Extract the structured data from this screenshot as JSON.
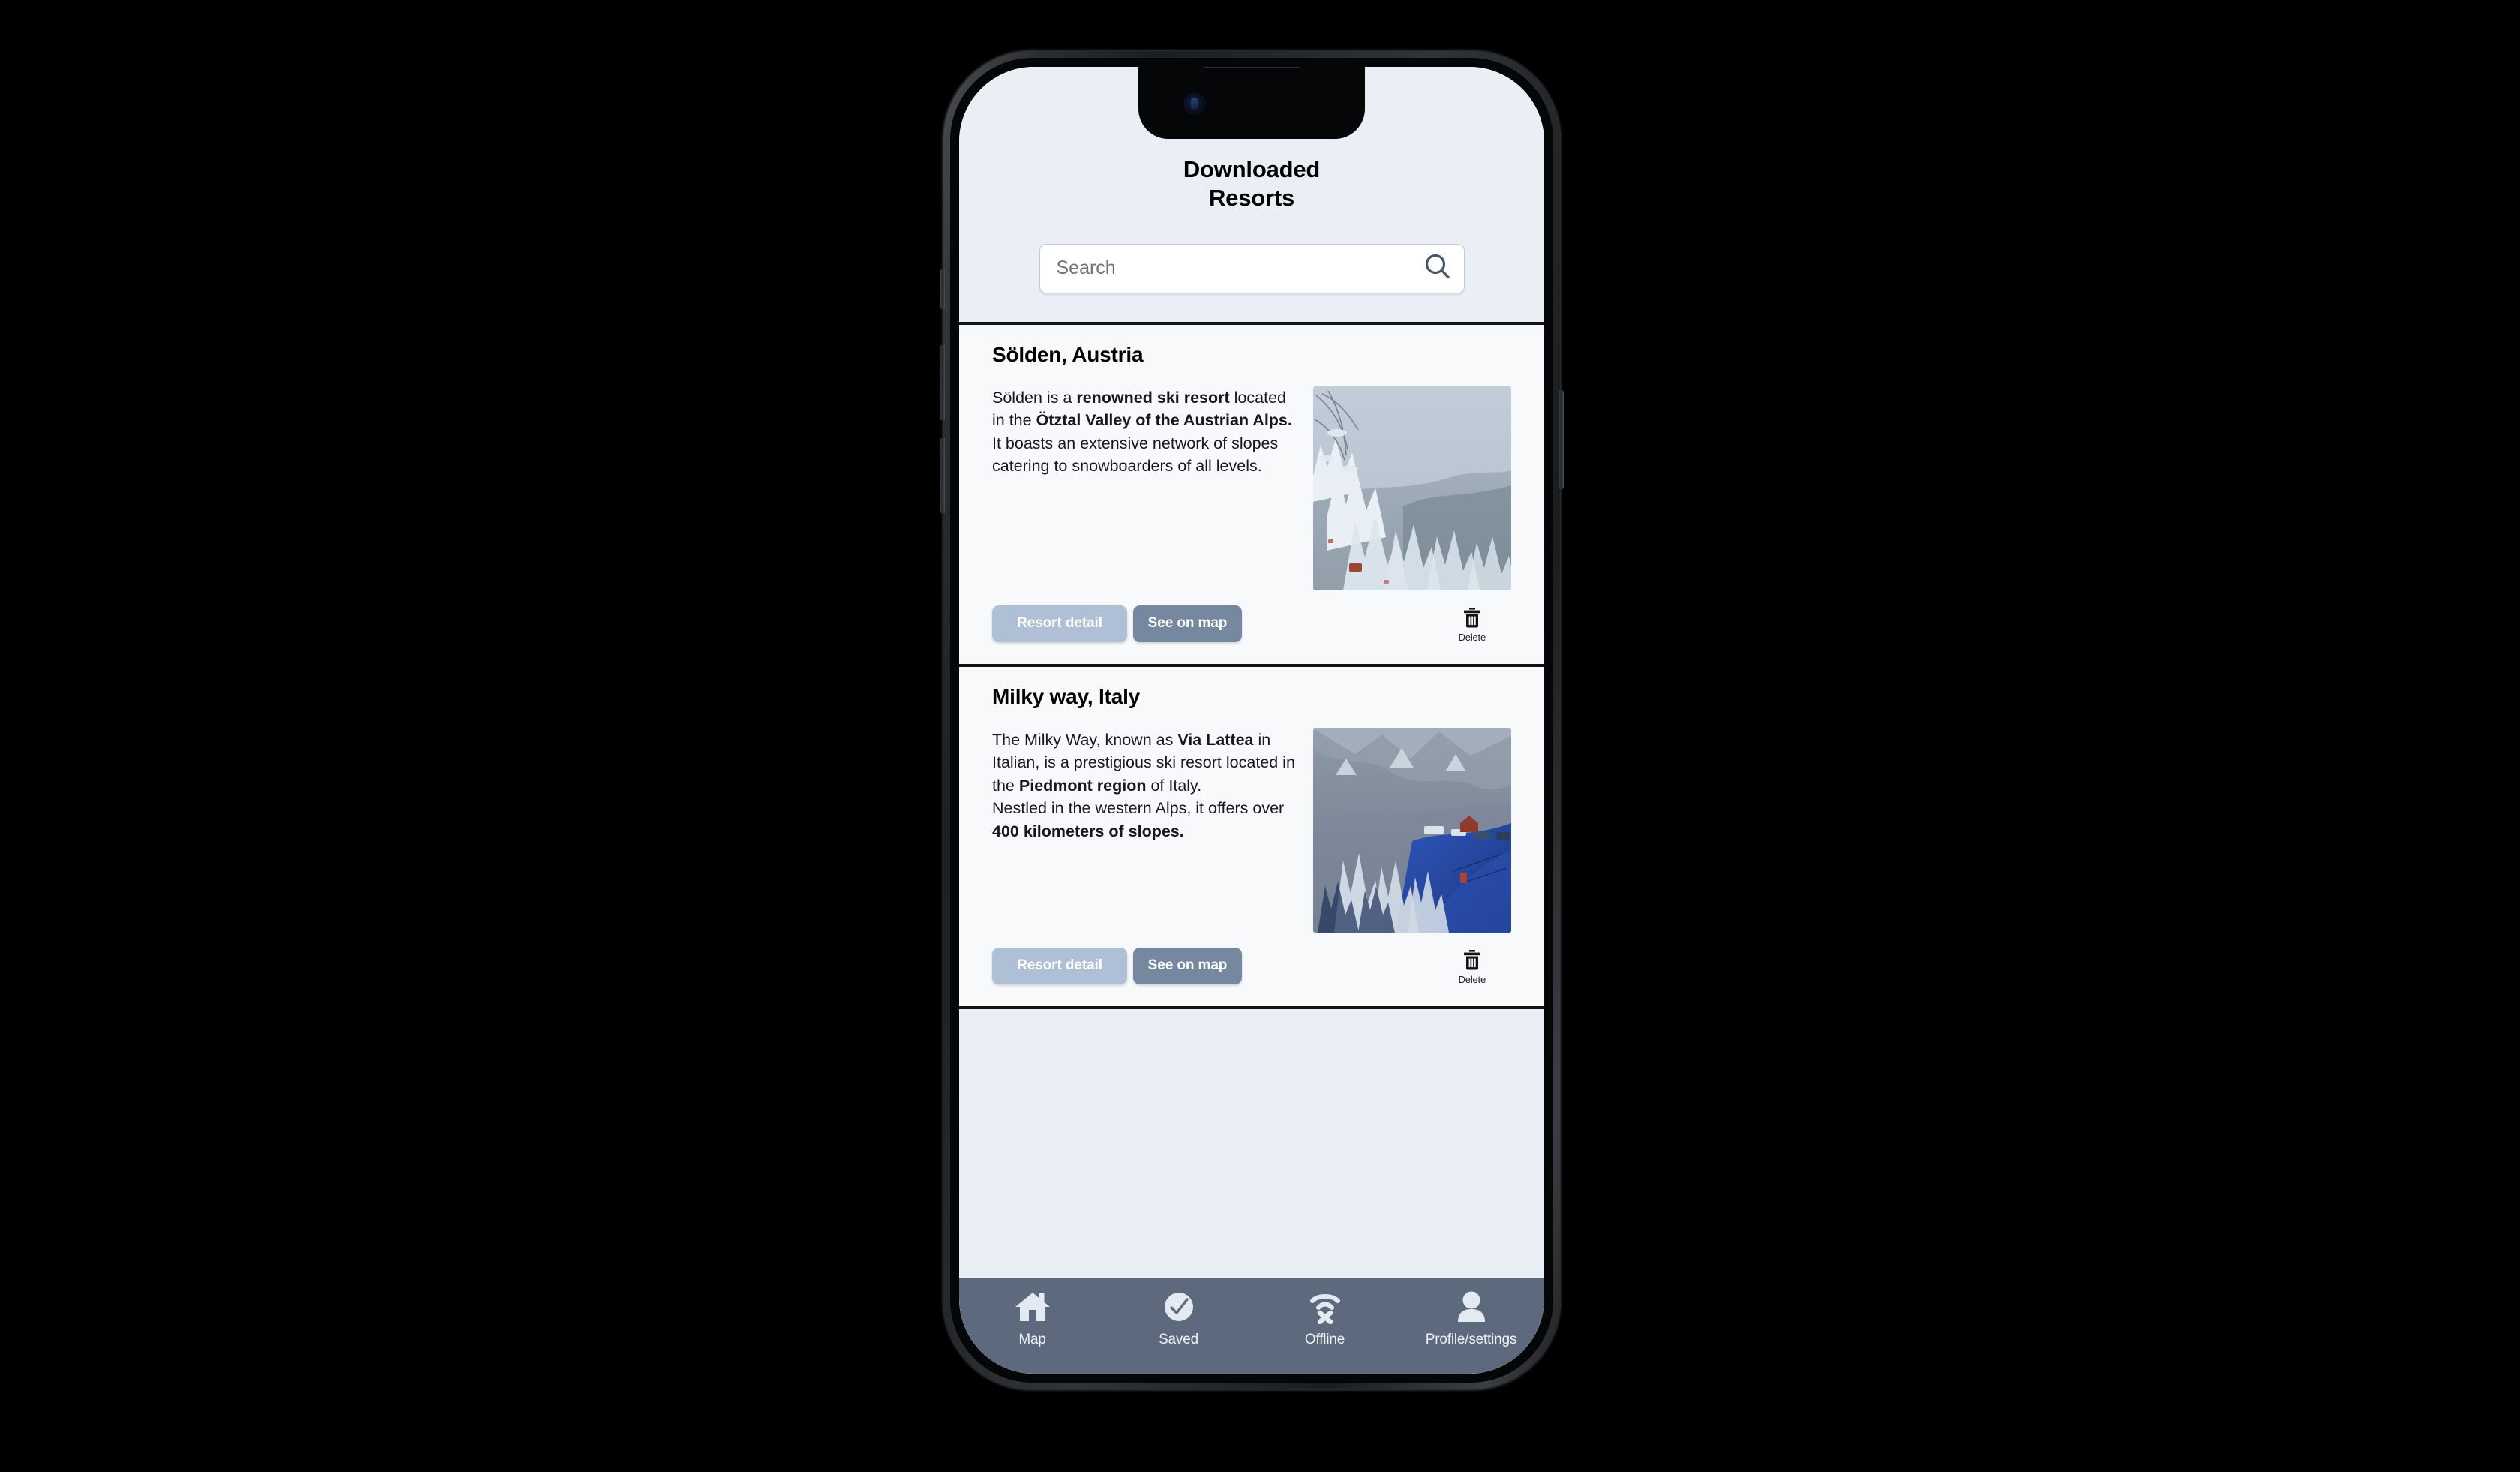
{
  "header": {
    "title": "Downloaded\nResorts"
  },
  "search": {
    "placeholder": "Search",
    "value": "",
    "icon": "search-icon"
  },
  "theme": {
    "screen_bg": "#eaeef5",
    "card_bg": "#f7f9fb",
    "divider": "#101214",
    "nav_bg": "#5d6a7d",
    "btn_detail_bg": "#afc0d6",
    "btn_map_bg": "#7688a0",
    "search_bg": "#ffffff"
  },
  "actions": {
    "detail_label": "Resort detail",
    "map_label": "See on map",
    "delete_label": "Delete",
    "delete_icon": "trash-icon"
  },
  "resorts": [
    {
      "name": "Sölden, Austria",
      "description_parts": [
        {
          "text": "Sölden is a ",
          "bold": false
        },
        {
          "text": "renowned ski resort",
          "bold": true
        },
        {
          "text": " located in the ",
          "bold": false
        },
        {
          "text": "Ötztal Valley of the Austrian Alps.",
          "bold": true
        },
        {
          "text": "\nIt boasts an extensive network of slopes catering to snowboarders of all levels.",
          "bold": false
        }
      ],
      "image_alt": "snow-covered-forest-photo"
    },
    {
      "name": "Milky way, Italy",
      "description_parts": [
        {
          "text": "The Milky Way, known as ",
          "bold": false
        },
        {
          "text": "Via Lattea",
          "bold": true
        },
        {
          "text": " in Italian, is a prestigious ski resort located in the ",
          "bold": false
        },
        {
          "text": "Piedmont region",
          "bold": true
        },
        {
          "text": " of Italy.\nNestled in the western Alps, it offers over ",
          "bold": false
        },
        {
          "text": "400 kilometers of slopes.",
          "bold": true
        }
      ],
      "image_alt": "ski-slope-valley-photo"
    }
  ],
  "bottom_nav": {
    "items": [
      {
        "label": "Map",
        "icon": "home-icon"
      },
      {
        "label": "Saved",
        "icon": "check-circle-icon"
      },
      {
        "label": "Offline",
        "icon": "wifi-off-icon"
      },
      {
        "label": "Profile/settings",
        "icon": "person-icon"
      }
    ]
  }
}
